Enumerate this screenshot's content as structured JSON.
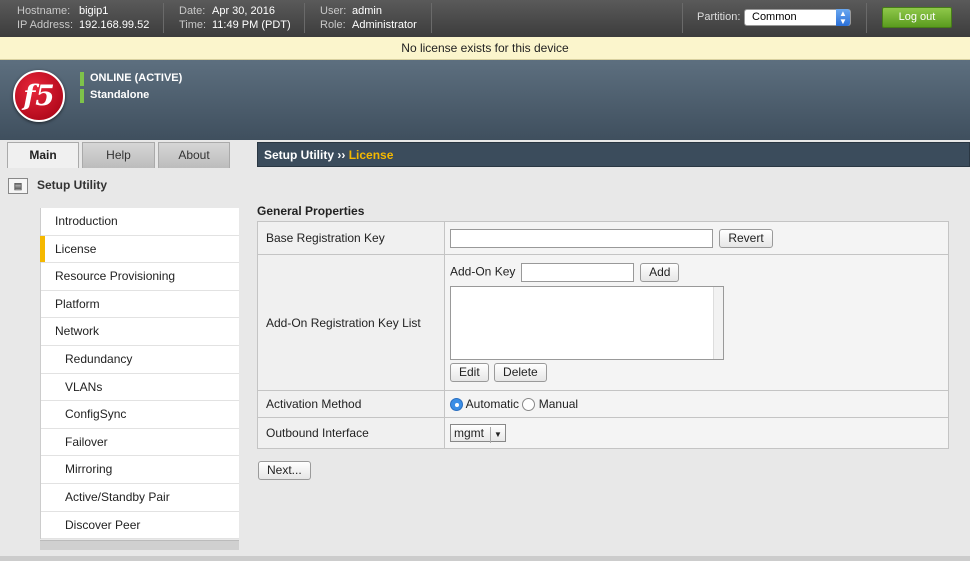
{
  "topbar": {
    "hostname_label": "Hostname:",
    "hostname": "bigip1",
    "ip_label": "IP Address:",
    "ip": "192.168.99.52",
    "date_label": "Date:",
    "date": "Apr 30, 2016",
    "time_label": "Time:",
    "time": "11:49 PM (PDT)",
    "user_label": "User:",
    "user": "admin",
    "role_label": "Role:",
    "role": "Administrator",
    "partition_label": "Partition:",
    "partition_value": "Common",
    "logout_label": "Log out"
  },
  "license_notice": "No license exists for this device",
  "header": {
    "logo_text": "f5",
    "status_1": "ONLINE (ACTIVE)",
    "status_2": "Standalone"
  },
  "tabs": [
    "Main",
    "Help",
    "About"
  ],
  "breadcrumb": {
    "parent": "Setup Utility",
    "separator": "››",
    "current": "License"
  },
  "sidebar": {
    "title": "Setup Utility",
    "items": [
      {
        "label": "Introduction"
      },
      {
        "label": "License"
      },
      {
        "label": "Resource Provisioning"
      },
      {
        "label": "Platform"
      },
      {
        "label": "Network"
      },
      {
        "label": "Redundancy"
      },
      {
        "label": "VLANs"
      },
      {
        "label": "ConfigSync"
      },
      {
        "label": "Failover"
      },
      {
        "label": "Mirroring"
      },
      {
        "label": "Active/Standby Pair"
      },
      {
        "label": "Discover Peer"
      }
    ]
  },
  "form": {
    "section_title": "General Properties",
    "base_key_label": "Base Registration Key",
    "revert_label": "Revert",
    "addon_list_label": "Add-On Registration Key List",
    "addon_key_label": "Add-On Key",
    "add_label": "Add",
    "edit_label": "Edit",
    "delete_label": "Delete",
    "activation_label": "Activation Method",
    "automatic_label": "Automatic",
    "manual_label": "Manual",
    "outbound_label": "Outbound Interface",
    "outbound_value": "mgmt",
    "next_label": "Next..."
  },
  "colors": {
    "accent": "#f5b800",
    "logout_green": "#6aad2a",
    "status_green": "#7ec24a",
    "license_bar": "#fbf5cc"
  }
}
